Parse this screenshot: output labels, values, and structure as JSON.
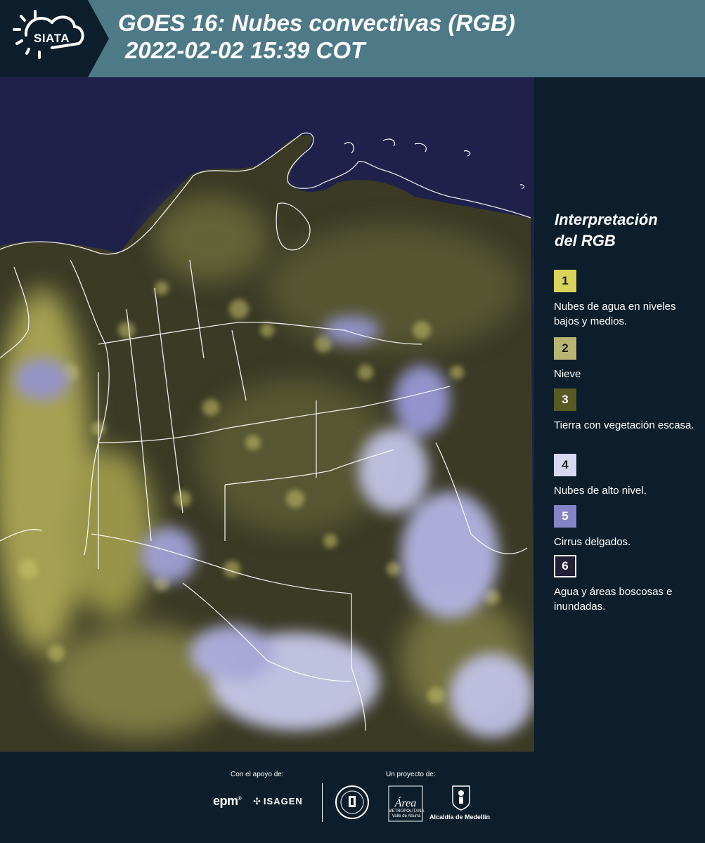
{
  "header": {
    "logo_text": "SIATA",
    "title_line1": "GOES 16: Nubes convectivas (RGB)",
    "title_line2": "2022-02-02 15:39 COT"
  },
  "legend": {
    "title_line1": "Interpretación",
    "title_line2": "del RGB",
    "items": [
      {
        "number": "1",
        "label": "Nubes de agua en niveles bajos y medios.",
        "color": "#d9d35a"
      },
      {
        "number": "2",
        "label": "Nieve",
        "color": "#b8b572"
      },
      {
        "number": "3",
        "label": "Tierra con vegetación escasa.",
        "color": "#575a23"
      },
      {
        "number": "4",
        "label": "Nubes de alto nivel.",
        "color": "#d7d8f2"
      },
      {
        "number": "5",
        "label": "Cirrus delgados.",
        "color": "#8584c6"
      },
      {
        "number": "6",
        "label": "Agua y áreas boscosas e inundadas.",
        "color": "#221f36"
      }
    ]
  },
  "footer": {
    "support_label": "Con el apoyo de:",
    "project_label": "Un proyecto de:",
    "epm": "epm",
    "isagen": "ISAGEN",
    "area_name": "Área",
    "area_sub": "METROPOLITANA Valle de Aburrá",
    "medellin": "Alcaldía de Medellín"
  },
  "colors": {
    "header_bg": "#4e7a88",
    "dark_bg": "#0c1e2b",
    "ocean": "#20214a",
    "low_clouds": "#d9d35a",
    "high_clouds": "#d7d8f2"
  }
}
